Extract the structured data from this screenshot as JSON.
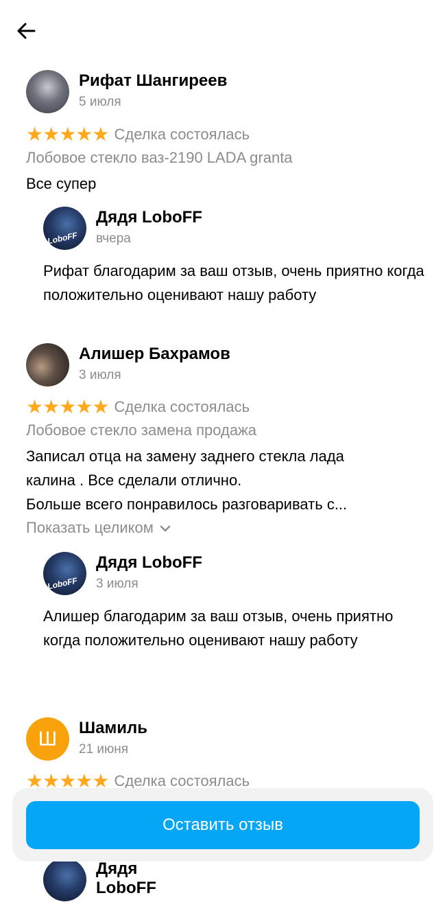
{
  "nav": {
    "back_icon": "arrow-left-icon"
  },
  "reviews": [
    {
      "author": "Рифат Шангиреев",
      "date": "5 июля",
      "stars": "★★★★★",
      "deal_status": "Сделка состоялась",
      "item": "Лобовое стекло ваз-2190 LADA granta",
      "text": "Все супер",
      "reply": {
        "author": "Дядя LoboFF",
        "date": "вчера",
        "logo": "LoboFF",
        "text": "Рифат благодарим за ваш отзыв, очень приятно когда положительно оценивают нашу работу"
      }
    },
    {
      "author": "Алишер Бахрамов",
      "date": "3 июля",
      "stars": "★★★★★",
      "deal_status": "Сделка состоялась",
      "item": "Лобовое стекло замена продажа",
      "text_lines": [
        "Записал отца на замену заднего стекла лада",
        "калина . Все сделали отлично.",
        "Больше всего понравилось разговаривать с..."
      ],
      "show_more": "Показать целиком",
      "reply": {
        "author": "Дядя LoboFF",
        "date": "3 июля",
        "logo": "LoboFF",
        "text": "Алишер благодарим за ваш отзыв, очень приятно когда положительно оценивают нашу работу"
      }
    },
    {
      "author": "Шамиль",
      "avatar_letter": "Ш",
      "date": "21 июня",
      "stars": "★★★★★",
      "deal_status": "Сделка состоялась"
    }
  ],
  "partial_reply_author": "Дядя LoboFF",
  "cta": {
    "label": "Оставить отзыв"
  },
  "colors": {
    "accent": "#05a6f5",
    "star": "#ffa81c",
    "avatar_letter_bg": "#f9a20b",
    "muted": "#8c8c8c"
  }
}
